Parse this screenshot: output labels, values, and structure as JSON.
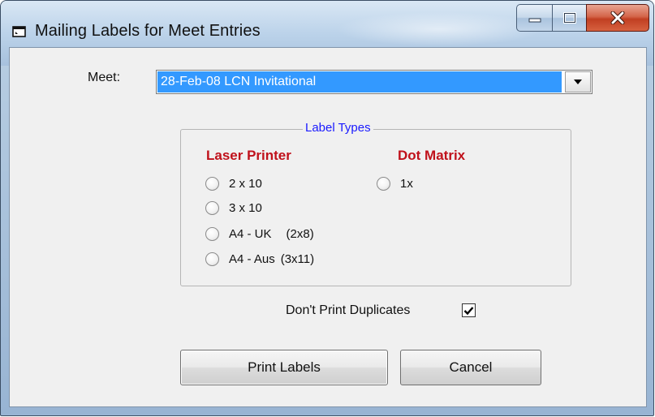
{
  "window": {
    "title": "Mailing Labels for Meet Entries",
    "icon": "app-window-icon",
    "buttons": {
      "minimize": "minimize-icon",
      "maximize": "maximize-icon",
      "close": "close-icon"
    }
  },
  "meet": {
    "label": "Meet:",
    "selected_value": "28-Feb-08 LCN Invitational"
  },
  "label_types": {
    "legend": "Label Types",
    "laser": {
      "heading": "Laser Printer",
      "options": [
        {
          "label": "2 x 10",
          "note": "",
          "selected": false
        },
        {
          "label": "3 x 10",
          "note": "",
          "selected": false
        },
        {
          "label": "A4 - UK",
          "note": "(2x8)",
          "selected": false
        },
        {
          "label": "A4 - Aus",
          "note": "(3x11)",
          "selected": false
        }
      ]
    },
    "dot_matrix": {
      "heading": "Dot Matrix",
      "options": [
        {
          "label": "1x",
          "selected": false
        }
      ]
    }
  },
  "duplicates": {
    "label": "Don't Print Duplicates",
    "checked": true
  },
  "actions": {
    "print_label": "Print Labels",
    "cancel_label": "Cancel"
  },
  "colors": {
    "selection": "#3399ff",
    "heading_red": "#c0111b",
    "legend_blue": "#1a1aff",
    "close_red": "#c13f22"
  }
}
